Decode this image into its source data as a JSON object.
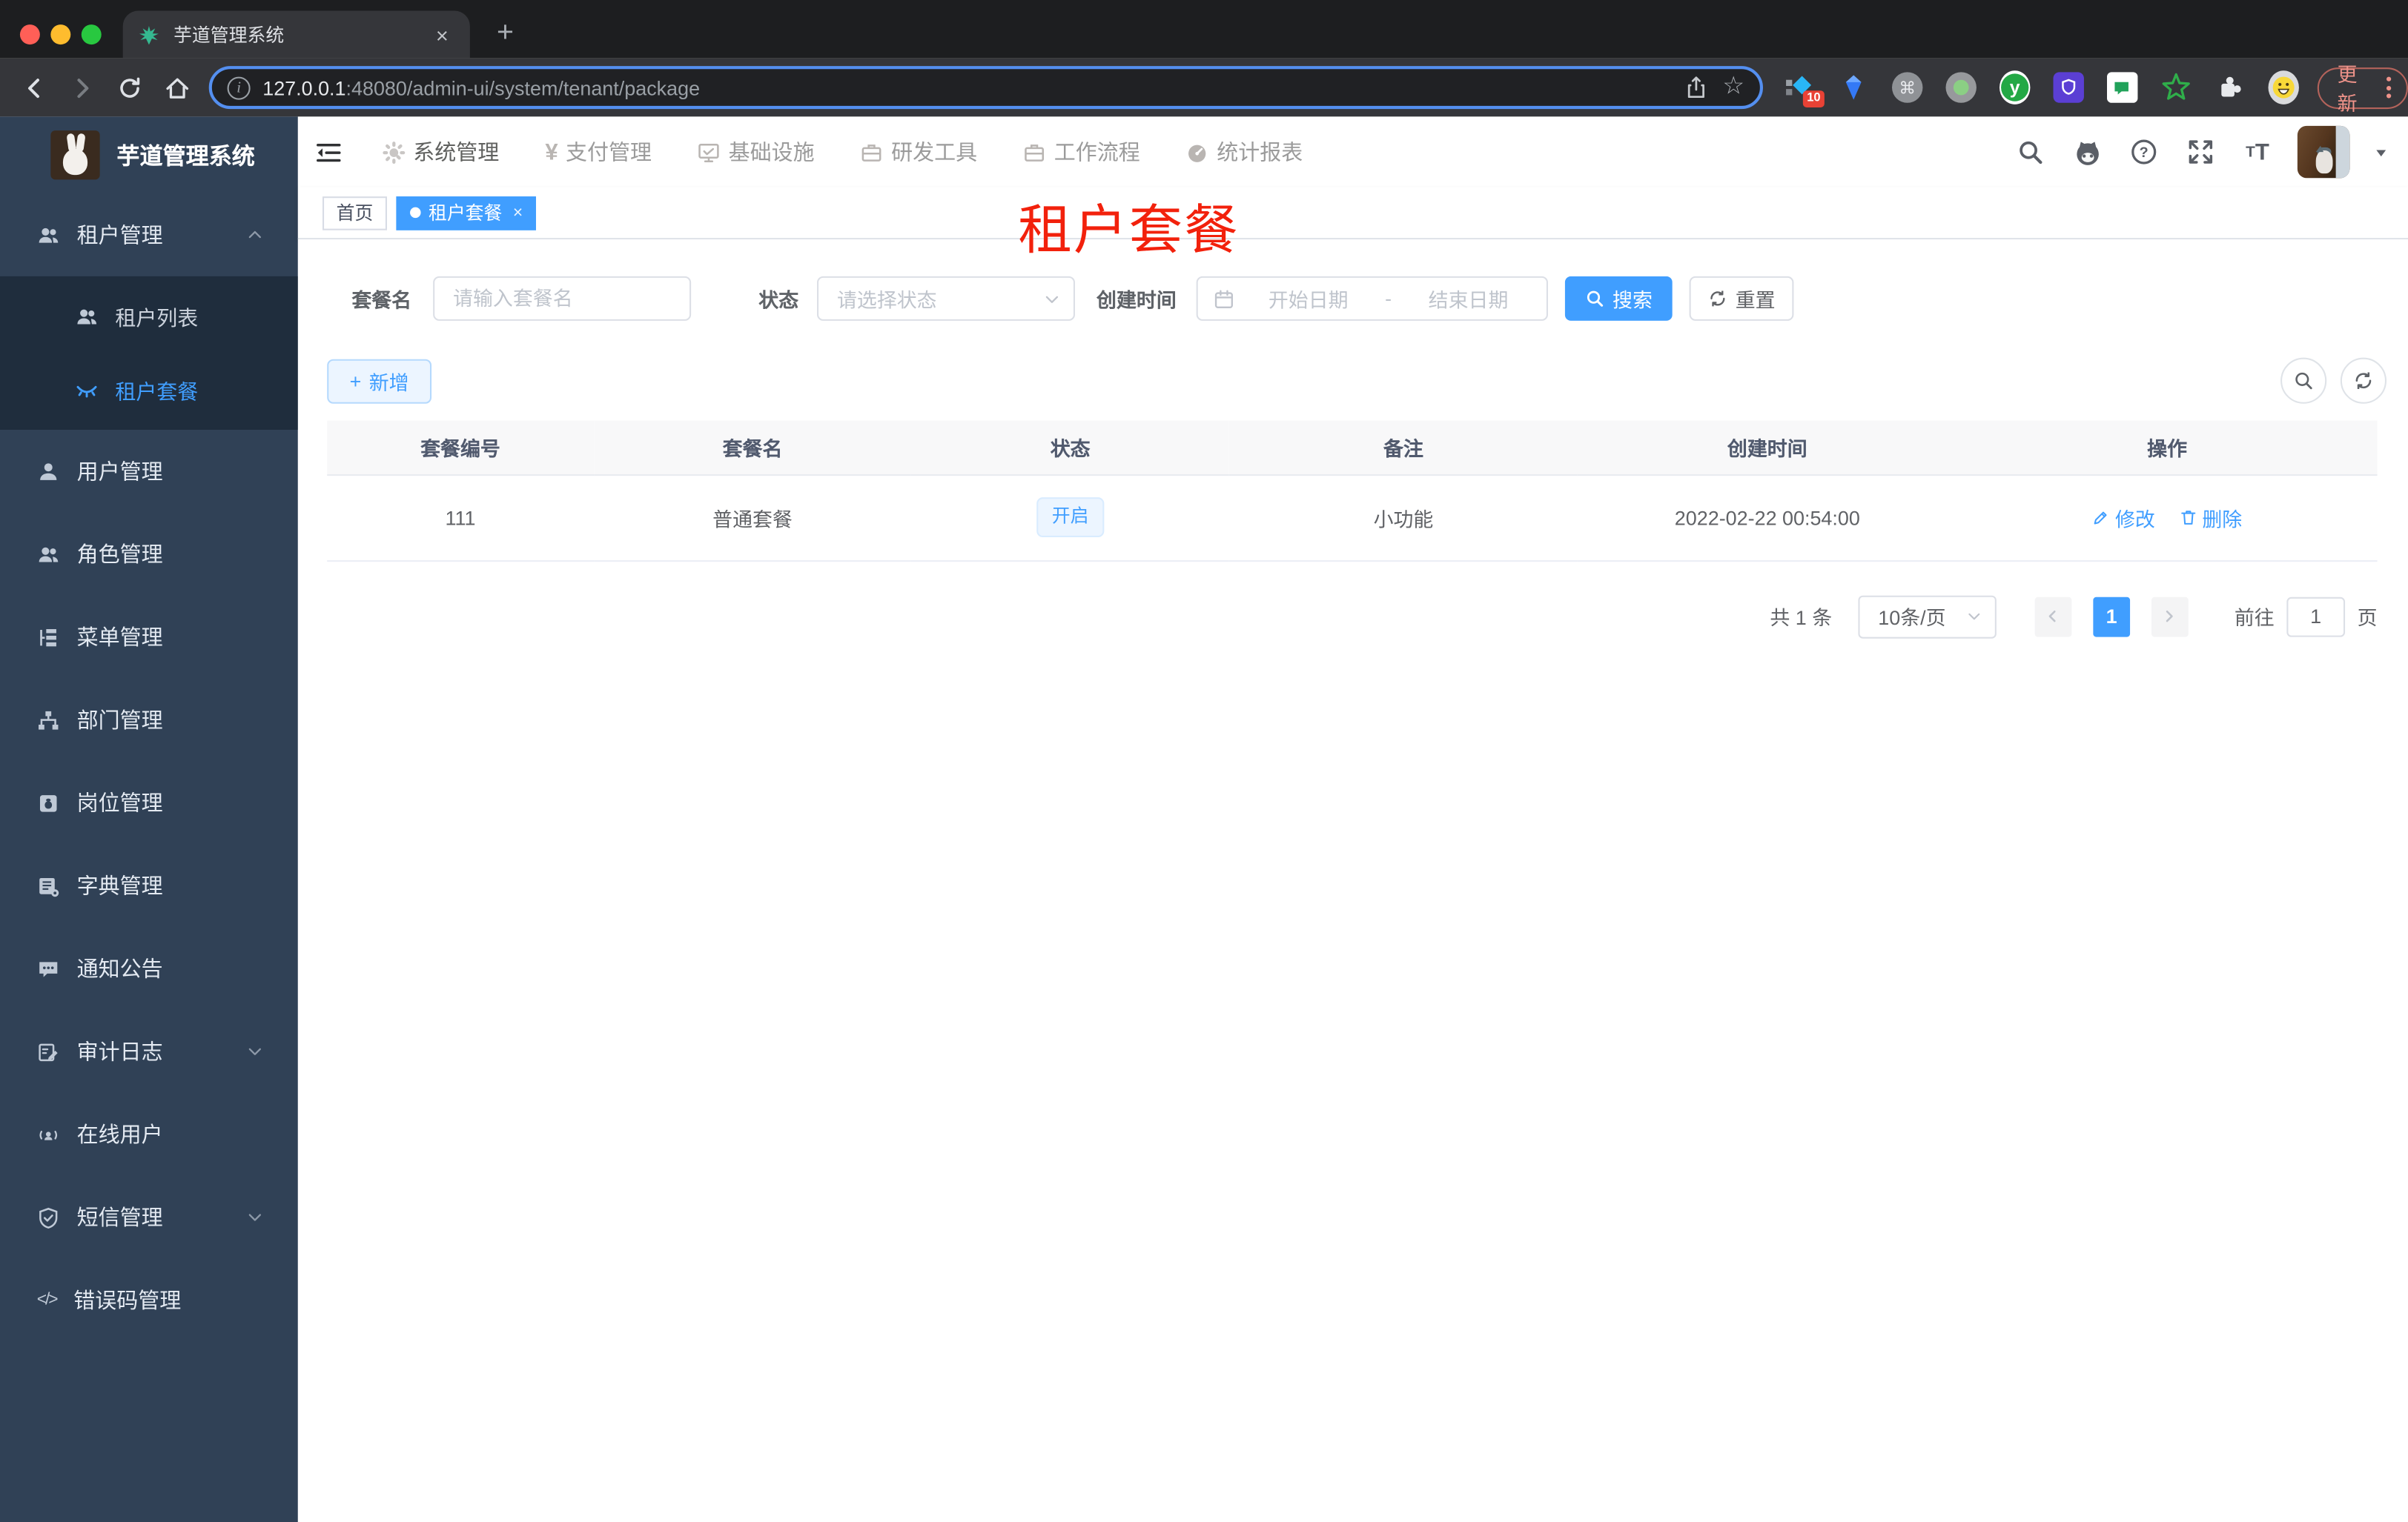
{
  "browser": {
    "tab_title": "芋道管理系统",
    "url_host": "127.0.0.1",
    "url_rest": ":48080/admin-ui/system/tenant/package",
    "update_label": "更新",
    "ext_badge": "10"
  },
  "icons": {
    "tab_close": "×",
    "new_tab": "+",
    "info": "i",
    "star": "☆",
    "command": "⌘",
    "ext_y": "y",
    "yen": "¥",
    "question": "?",
    "font_big": "T",
    "font_small": "T",
    "code": "</>",
    "tag_close": "×",
    "plus": "+"
  },
  "sidebar": {
    "app_title": "芋道管理系统",
    "tenant_group": {
      "label": "租户管理"
    },
    "tenant_children": [
      {
        "label": "租户列表"
      },
      {
        "label": "租户套餐"
      }
    ],
    "items": [
      {
        "label": "用户管理"
      },
      {
        "label": "角色管理"
      },
      {
        "label": "菜单管理"
      },
      {
        "label": "部门管理"
      },
      {
        "label": "岗位管理"
      },
      {
        "label": "字典管理"
      },
      {
        "label": "通知公告"
      },
      {
        "label": "审计日志"
      },
      {
        "label": "在线用户"
      },
      {
        "label": "短信管理"
      },
      {
        "label": "错误码管理"
      }
    ]
  },
  "topnav": {
    "items": [
      {
        "label": "系统管理"
      },
      {
        "label": "支付管理"
      },
      {
        "label": "基础设施"
      },
      {
        "label": "研发工具"
      },
      {
        "label": "工作流程"
      },
      {
        "label": "统计报表"
      }
    ]
  },
  "tags": {
    "home": "首页",
    "active": "租户套餐"
  },
  "page": {
    "overlay_title": "租户套餐"
  },
  "filters": {
    "name_label": "套餐名",
    "name_placeholder": "请输入套餐名",
    "status_label": "状态",
    "status_placeholder": "请选择状态",
    "time_label": "创建时间",
    "start_placeholder": "开始日期",
    "range_separator": "-",
    "end_placeholder": "结束日期",
    "search_label": "搜索",
    "reset_label": "重置"
  },
  "toolbar": {
    "add_label": "新增"
  },
  "table": {
    "columns": [
      "套餐编号",
      "套餐名",
      "状态",
      "备注",
      "创建时间",
      "操作"
    ],
    "row": {
      "id": "111",
      "name": "普通套餐",
      "status": "开启",
      "remark": "小功能",
      "created_at": "2022-02-22 00:54:00",
      "edit_label": "修改",
      "delete_label": "删除"
    }
  },
  "pagination": {
    "total": "共 1 条",
    "size": "10条/页",
    "page": "1",
    "goto_label": "前往",
    "goto_value": "1",
    "unit_label": "页"
  }
}
